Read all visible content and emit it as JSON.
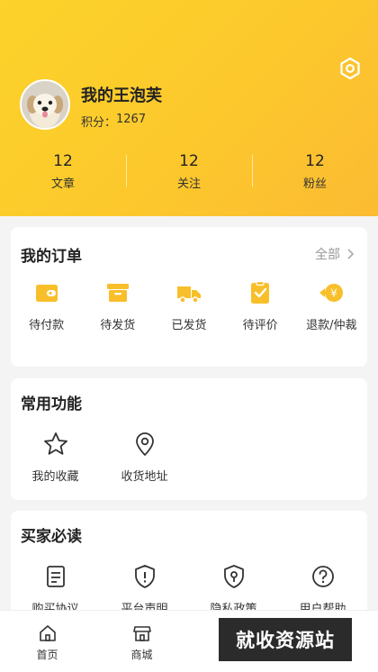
{
  "profile": {
    "name": "我的王泡芙",
    "points_label": "积分：",
    "points_value": "1267"
  },
  "stats": [
    {
      "value": "12",
      "label": "文章"
    },
    {
      "value": "12",
      "label": "关注"
    },
    {
      "value": "12",
      "label": "粉丝"
    }
  ],
  "orders": {
    "title": "我的订单",
    "more_label": "全部",
    "items": [
      {
        "label": "待付款",
        "icon": "wallet-icon"
      },
      {
        "label": "待发货",
        "icon": "box-icon"
      },
      {
        "label": "已发货",
        "icon": "truck-icon"
      },
      {
        "label": "待评价",
        "icon": "review-icon"
      },
      {
        "label": "退款/仲裁",
        "icon": "refund-icon"
      }
    ]
  },
  "functions": {
    "title": "常用功能",
    "items": [
      {
        "label": "我的收藏",
        "icon": "star-icon"
      },
      {
        "label": "收货地址",
        "icon": "location-icon"
      }
    ]
  },
  "reading": {
    "title": "买家必读",
    "items": [
      {
        "label": "购买协议",
        "icon": "document-icon"
      },
      {
        "label": "平台声明",
        "icon": "shield-alert-icon"
      },
      {
        "label": "隐私政策",
        "icon": "privacy-shield-icon"
      },
      {
        "label": "用户帮助",
        "icon": "help-icon"
      }
    ]
  },
  "tabbar": [
    {
      "label": "首页",
      "icon": "home-icon"
    },
    {
      "label": "商城",
      "icon": "shop-icon"
    }
  ],
  "watermark": "就收资源站",
  "colors": {
    "accent": "#fcc82c",
    "icon_yellow": "#f8bf2a"
  }
}
